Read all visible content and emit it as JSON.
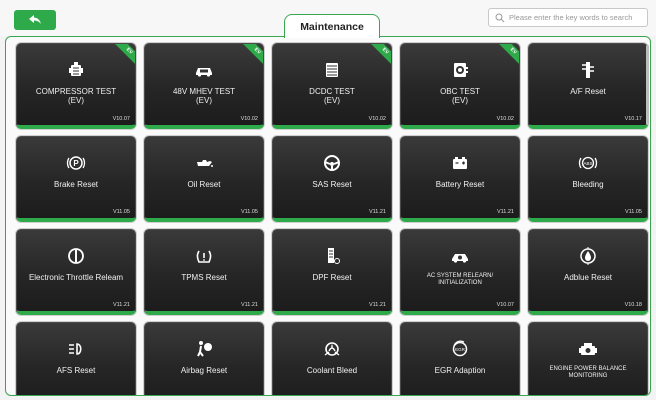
{
  "header": {
    "title": "Maintenance",
    "search_placeholder": "Please enter the key words to search"
  },
  "tiles": [
    {
      "label": "COMPRESSOR TEST\n(EV)",
      "version": "V10.07",
      "icon": "compressor-icon",
      "ev": true
    },
    {
      "label": "48V MHEV TEST\n(EV)",
      "version": "V10.02",
      "icon": "car-battery-icon",
      "ev": true
    },
    {
      "label": "DCDC TEST\n(EV)",
      "version": "V10.02",
      "icon": "dcdc-icon",
      "ev": true
    },
    {
      "label": "OBC TEST\n(EV)",
      "version": "V10.02",
      "icon": "obc-icon",
      "ev": true
    },
    {
      "label": "A/F Reset",
      "version": "V10.17",
      "icon": "af-sensor-icon",
      "ev": false
    },
    {
      "label": "Brake Reset",
      "version": "V11.05",
      "icon": "parking-brake-icon",
      "ev": false
    },
    {
      "label": "Oil Reset",
      "version": "V11.05",
      "icon": "oil-can-icon",
      "ev": false
    },
    {
      "label": "SAS Reset",
      "version": "V11.21",
      "icon": "steering-wheel-icon",
      "ev": false
    },
    {
      "label": "Battery Reset",
      "version": "V11.21",
      "icon": "battery-icon",
      "ev": false
    },
    {
      "label": "Bleeding",
      "version": "V11.05",
      "icon": "abs-icon",
      "ev": false
    },
    {
      "label": "Electronic Throttle Releam",
      "version": "V11.21",
      "icon": "throttle-icon",
      "ev": false
    },
    {
      "label": "TPMS Reset",
      "version": "V11.21",
      "icon": "tpms-icon",
      "ev": false
    },
    {
      "label": "DPF Reset",
      "version": "V11.21",
      "icon": "dpf-icon",
      "ev": false
    },
    {
      "label": "AC SYSTEM RELEARN/\nINITIALIZATION",
      "version": "V10.07",
      "icon": "ac-car-icon",
      "ev": false,
      "small": true
    },
    {
      "label": "Adblue Reset",
      "version": "V10.18",
      "icon": "adblue-icon",
      "ev": false
    },
    {
      "label": "AFS Reset",
      "version": "",
      "icon": "afs-headlight-icon",
      "ev": false
    },
    {
      "label": "Airbag Reset",
      "version": "",
      "icon": "airbag-icon",
      "ev": false
    },
    {
      "label": "Coolant Bleed",
      "version": "",
      "icon": "coolant-icon",
      "ev": false
    },
    {
      "label": "EGR Adaption",
      "version": "",
      "icon": "egr-icon",
      "ev": false
    },
    {
      "label": "ENGINE POWER BALANCE\nMONITORING",
      "version": "",
      "icon": "engine-icon",
      "ev": false,
      "small": true
    }
  ],
  "ev_badge": "EV",
  "colors": {
    "accent": "#2eaa4a",
    "tile_bg": "#262626",
    "page_bg": "#f3f3f3"
  }
}
